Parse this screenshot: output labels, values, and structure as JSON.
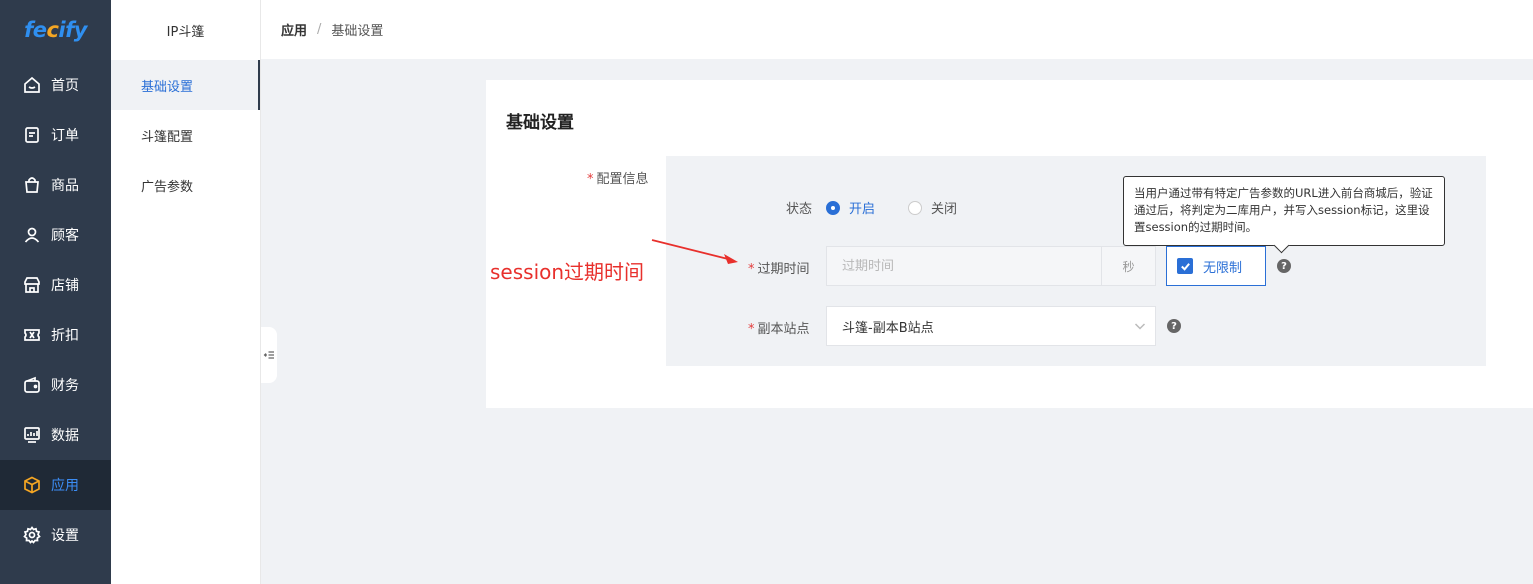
{
  "logo": {
    "part1": "fe",
    "part2": "c",
    "part3": "ify"
  },
  "nav": {
    "items": [
      {
        "label": "首页",
        "icon": "home-icon"
      },
      {
        "label": "订单",
        "icon": "order-icon"
      },
      {
        "label": "商品",
        "icon": "bag-icon"
      },
      {
        "label": "顾客",
        "icon": "user-icon"
      },
      {
        "label": "店铺",
        "icon": "store-icon"
      },
      {
        "label": "折扣",
        "icon": "ticket-icon"
      },
      {
        "label": "财务",
        "icon": "wallet-icon"
      },
      {
        "label": "数据",
        "icon": "chart-icon"
      },
      {
        "label": "应用",
        "icon": "box-icon",
        "active": true
      },
      {
        "label": "设置",
        "icon": "gear-icon"
      }
    ]
  },
  "sub": {
    "title": "IP斗篷",
    "items": [
      {
        "label": "基础设置",
        "active": true
      },
      {
        "label": "斗篷配置"
      },
      {
        "label": "广告参数"
      }
    ]
  },
  "breadcrumb": {
    "first": "应用",
    "sep": "/",
    "second": "基础设置"
  },
  "card": {
    "title": "基础设置",
    "config_label": "配置信息",
    "status": {
      "label": "状态",
      "on": "开启",
      "off": "关闭",
      "selected": "开启"
    },
    "expire": {
      "label": "过期时间",
      "placeholder": "过期时间",
      "suffix": "秒",
      "unlimited": "无限制",
      "unlimited_checked": true
    },
    "site": {
      "label": "副本站点",
      "value": "斗篷-副本B站点"
    },
    "required_mark": "*",
    "help_glyph": "?"
  },
  "tooltip": {
    "text": "当用户通过带有特定广告参数的URL进入前台商城后，验证通过后，将判定为二库用户，并写入session标记，这里设置session的过期时间。"
  },
  "annotation": {
    "text": "session过期时间",
    "color": "#e8302c"
  },
  "colors": {
    "nav_bg": "#2f3b4c",
    "accent": "#2a6fd6",
    "active_icon": "#f5a623"
  }
}
